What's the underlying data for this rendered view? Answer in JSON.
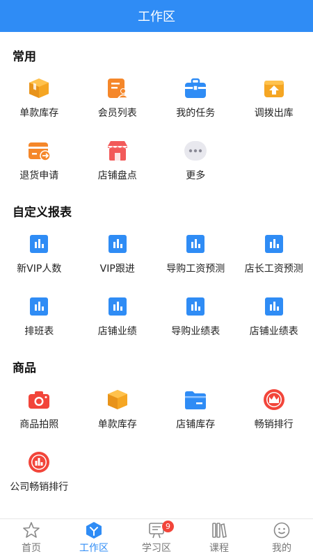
{
  "header": {
    "title": "工作区"
  },
  "sections": [
    {
      "title": "常用",
      "items": [
        {
          "label": "单款库存",
          "icon": "box-icon"
        },
        {
          "label": "会员列表",
          "icon": "member-list-icon"
        },
        {
          "label": "我的任务",
          "icon": "briefcase-icon"
        },
        {
          "label": "调拨出库",
          "icon": "transfer-out-icon"
        },
        {
          "label": "退货申请",
          "icon": "return-icon"
        },
        {
          "label": "店铺盘点",
          "icon": "shop-icon"
        },
        {
          "label": "更多",
          "icon": "more-icon"
        }
      ]
    },
    {
      "title": "自定义报表",
      "items": [
        {
          "label": "新VIP人数",
          "icon": "report-chart-icon"
        },
        {
          "label": "VIP跟进",
          "icon": "report-chart-icon"
        },
        {
          "label": "导购工资预测",
          "icon": "report-chart-icon"
        },
        {
          "label": "店长工资预测",
          "icon": "report-chart-icon"
        },
        {
          "label": "排班表",
          "icon": "report-chart-icon"
        },
        {
          "label": "店铺业绩",
          "icon": "report-chart-icon"
        },
        {
          "label": "导购业绩表",
          "icon": "report-chart-icon"
        },
        {
          "label": "店铺业绩表",
          "icon": "report-chart-icon"
        }
      ]
    },
    {
      "title": "商品",
      "items": [
        {
          "label": "商品拍照",
          "icon": "camera-icon"
        },
        {
          "label": "单款库存",
          "icon": "box-icon"
        },
        {
          "label": "店铺库存",
          "icon": "folder-icon"
        },
        {
          "label": "畅销排行",
          "icon": "crown-icon"
        },
        {
          "label": "公司畅销排行",
          "icon": "ranking-chart-icon"
        }
      ]
    }
  ],
  "tabbar": {
    "tabs": [
      {
        "label": "首页",
        "icon": "home-star-icon"
      },
      {
        "label": "工作区",
        "icon": "workspace-icon",
        "active": true
      },
      {
        "label": "学习区",
        "icon": "study-icon",
        "badge": "9"
      },
      {
        "label": "课程",
        "icon": "books-icon"
      },
      {
        "label": "我的",
        "icon": "profile-face-icon"
      }
    ]
  },
  "colors": {
    "primary": "#2f8cf5",
    "orange": "#f5a623",
    "red": "#f2453a",
    "badge": "#f2453a"
  }
}
